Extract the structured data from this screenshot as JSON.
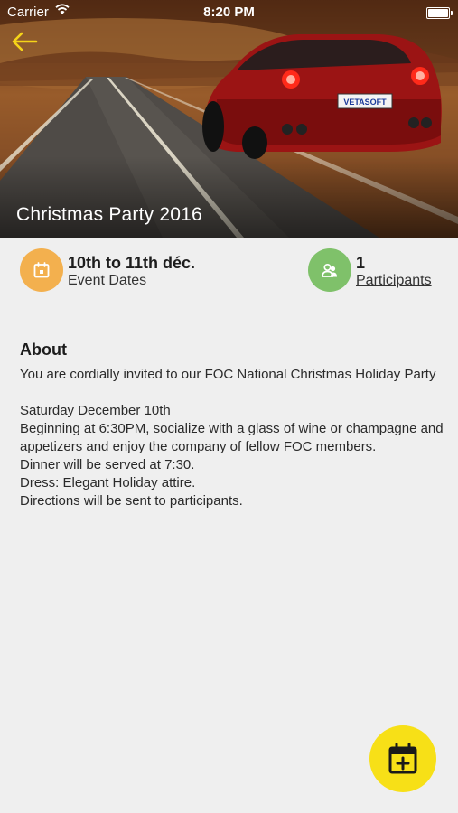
{
  "status_bar": {
    "carrier": "Carrier",
    "time": "8:20 PM"
  },
  "hero": {
    "title": "Christmas Party 2016",
    "plate_text": "VETASOFT"
  },
  "info": {
    "dates_value": "10th to 11th déc.",
    "dates_label": "Event Dates",
    "participants_count": "1",
    "participants_label": "Participants"
  },
  "about": {
    "heading": "About",
    "paragraphs": [
      "You are cordially invited to our FOC National Christmas Holiday Party",
      "",
      "Saturday December 10th",
      "Beginning at 6:30PM, socialize with a glass of wine or champagne and appetizers and enjoy the company of fellow FOC members.",
      "Dinner will be served at 7:30.",
      "Dress: Elegant Holiday attire.",
      "Directions will be sent to participants."
    ]
  },
  "colors": {
    "dates_circle": "#f3b04e",
    "participants_circle": "#7fc16a",
    "fab": "#f7e017",
    "back_arrow": "#f5d419",
    "background": "#efefef"
  },
  "icons": {
    "back": "arrow-left-icon",
    "dates": "calendar-icon",
    "participants": "users-icon",
    "fab": "calendar-add-icon",
    "wifi": "wifi-icon",
    "battery": "battery-icon"
  }
}
